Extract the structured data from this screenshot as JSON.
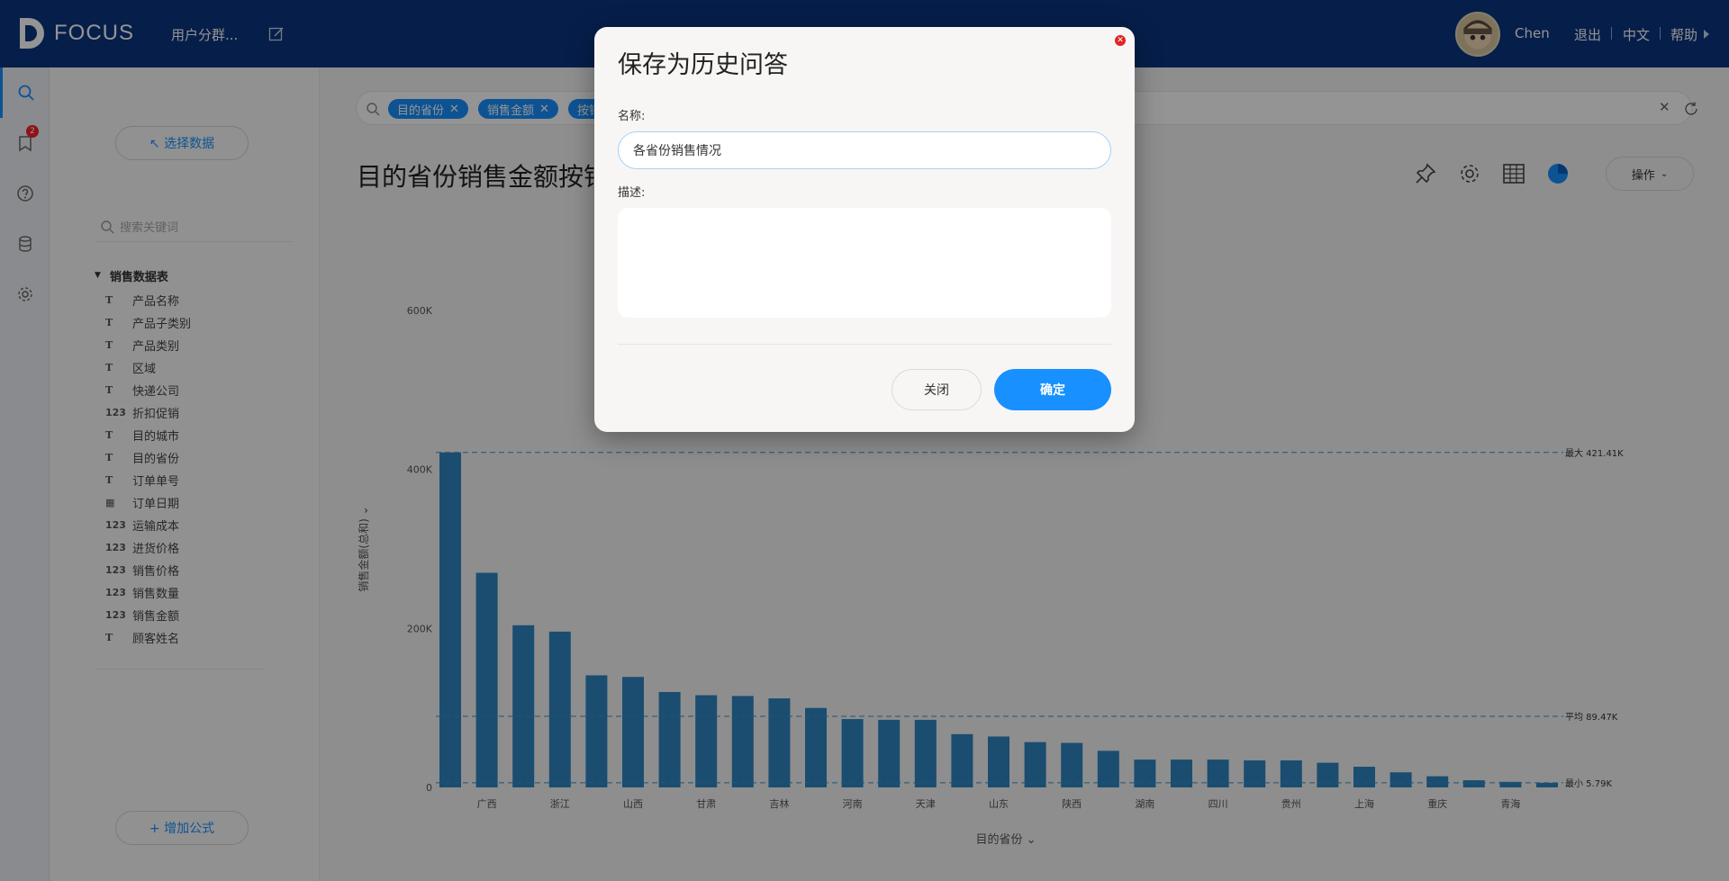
{
  "header": {
    "logo_text": "FOCUS",
    "project_name": "用户分群...",
    "user_name": "Chen",
    "links": {
      "logout": "退出",
      "language": "中文",
      "help": "帮助"
    }
  },
  "rail": {
    "notification_count": "2"
  },
  "panel": {
    "select_data_label": "↖ 选择数据",
    "search_placeholder": "搜索关键词",
    "table_name": "销售数据表",
    "fields": [
      {
        "type": "T",
        "name": "产品名称"
      },
      {
        "type": "T",
        "name": "产品子类别"
      },
      {
        "type": "T",
        "name": "产品类别"
      },
      {
        "type": "T",
        "name": "区域"
      },
      {
        "type": "T",
        "name": "快递公司"
      },
      {
        "type": "123",
        "name": "折扣促销"
      },
      {
        "type": "T",
        "name": "目的城市"
      },
      {
        "type": "T",
        "name": "目的省份"
      },
      {
        "type": "T",
        "name": "订单单号"
      },
      {
        "type": "date",
        "name": "订单日期"
      },
      {
        "type": "123",
        "name": "运输成本"
      },
      {
        "type": "123",
        "name": "进货价格"
      },
      {
        "type": "123",
        "name": "销售价格"
      },
      {
        "type": "123",
        "name": "销售数量"
      },
      {
        "type": "123",
        "name": "销售金额"
      },
      {
        "type": "T",
        "name": "顾客姓名"
      }
    ],
    "add_formula_label": "+ 增加公式"
  },
  "main": {
    "chips": [
      "目的省份",
      "销售金额",
      "按销"
    ],
    "page_title": "目的省份销售金额按销",
    "action_label": "操作"
  },
  "chart_data": {
    "type": "bar",
    "xlabel": "目的省份",
    "ylabel": "销售金额(总和)",
    "ylim": [
      0,
      600000
    ],
    "yticks": [
      "0",
      "200K",
      "400K",
      "600K"
    ],
    "ytick_values": [
      0,
      200000,
      400000,
      600000
    ],
    "x_tick_labels": [
      "广西",
      "浙江",
      "山西",
      "甘肃",
      "吉林",
      "河南",
      "天津",
      "山东",
      "陕西",
      "湖南",
      "四川",
      "贵州",
      "上海",
      "重庆",
      "青海"
    ],
    "values": [
      421410,
      270000,
      204000,
      196000,
      141000,
      139000,
      120000,
      116000,
      115000,
      112000,
      100000,
      86000,
      85000,
      85000,
      67000,
      64000,
      57000,
      56000,
      46000,
      35000,
      35000,
      35000,
      34000,
      34000,
      31000,
      26000,
      19000,
      14000,
      9000,
      7000,
      5790
    ],
    "ref_lines": [
      {
        "label": "最大 421.41K",
        "value": 421410
      },
      {
        "label": "平均 89.47K",
        "value": 89470
      },
      {
        "label": "最小 5.79K",
        "value": 5790
      }
    ],
    "bar_color": "#2e86c1"
  },
  "dialog": {
    "title": "保存为历史问答",
    "name_label": "名称:",
    "name_value": "各省份销售情况",
    "desc_label": "描述:",
    "cancel_label": "关闭",
    "ok_label": "确定",
    "accent": "#1890ff"
  }
}
